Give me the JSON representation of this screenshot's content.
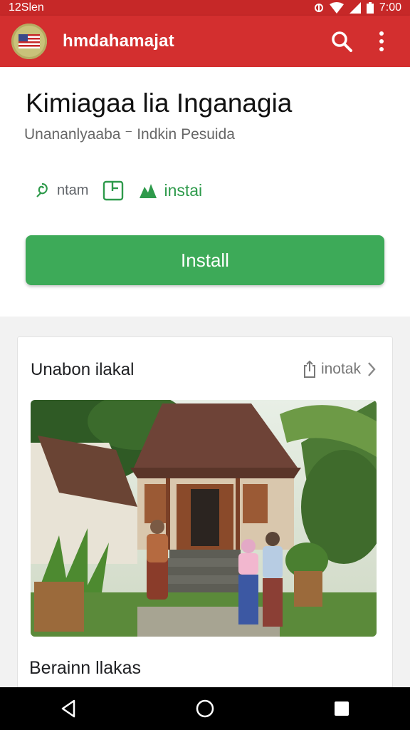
{
  "status_bar": {
    "left_text": "12Slen",
    "time": "7:00"
  },
  "app_bar": {
    "title": "hmdahamajat",
    "icons": [
      "flag-logo-icon",
      "search-icon",
      "more-vert-icon"
    ]
  },
  "app": {
    "name": "Kimiagaa lia Inganagia",
    "subtitle": "Unananlyaaba ⁻ Indkin Pesuida",
    "meta": [
      {
        "icon": "leaf-icon",
        "label": "ntam"
      },
      {
        "icon": "share-box-icon",
        "label": ""
      },
      {
        "icon": "install-arrow-icon",
        "label": "instai"
      }
    ],
    "install_label": "Install"
  },
  "card": {
    "title": "Unabon ilakal",
    "action_label": "inotak",
    "bottom_title": "Berainn llakas"
  },
  "colors": {
    "appbar": "#d32f2f",
    "install": "#3daa58",
    "accent_green": "#2e9a4b"
  }
}
